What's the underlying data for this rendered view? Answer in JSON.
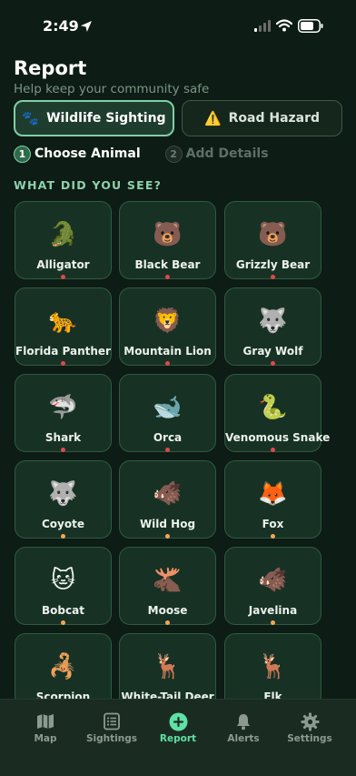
{
  "status": {
    "time": "2:49"
  },
  "header": {
    "title": "Report",
    "subtitle": "Help keep your community safe"
  },
  "segments": {
    "wildlife": {
      "label": "Wildlife Sighting",
      "icon": "🐾"
    },
    "road": {
      "label": "Road Hazard",
      "icon": "⚠️"
    }
  },
  "steps": [
    {
      "num": "1",
      "label": "Choose Animal"
    },
    {
      "num": "2",
      "label": "Add Details"
    }
  ],
  "section_label": "WHAT DID YOU SEE?",
  "colors": {
    "accent": "#5fe0a4",
    "danger_dot": "#e0474c",
    "caution_dot": "#f2a65a"
  },
  "animals": [
    {
      "name": "Alligator",
      "emoji": "🐊",
      "risk": "danger"
    },
    {
      "name": "Black Bear",
      "emoji": "🐻",
      "risk": "danger"
    },
    {
      "name": "Grizzly Bear",
      "emoji": "🐻",
      "risk": "danger"
    },
    {
      "name": "Florida Panther",
      "emoji": "🐆",
      "risk": "danger"
    },
    {
      "name": "Mountain Lion",
      "emoji": "🦁",
      "risk": "danger"
    },
    {
      "name": "Gray Wolf",
      "emoji": "🐺",
      "risk": "danger"
    },
    {
      "name": "Shark",
      "emoji": "🦈",
      "risk": "danger"
    },
    {
      "name": "Orca",
      "emoji": "🐋",
      "risk": "danger"
    },
    {
      "name": "Venomous Snake",
      "emoji": "🐍",
      "risk": "danger"
    },
    {
      "name": "Coyote",
      "emoji": "🐺",
      "risk": "caution"
    },
    {
      "name": "Wild Hog",
      "emoji": "🐗",
      "risk": "caution"
    },
    {
      "name": "Fox",
      "emoji": "🦊",
      "risk": "caution"
    },
    {
      "name": "Bobcat",
      "emoji": "🐱",
      "risk": "caution"
    },
    {
      "name": "Moose",
      "emoji": "🫎",
      "risk": "caution"
    },
    {
      "name": "Javelina",
      "emoji": "🐗",
      "risk": "caution"
    },
    {
      "name": "Scorpion",
      "emoji": "🦂",
      "risk": "caution"
    },
    {
      "name": "White-Tail Deer",
      "emoji": "🦌",
      "risk": "caution"
    },
    {
      "name": "Elk",
      "emoji": "🦌",
      "risk": "caution"
    }
  ],
  "tabs": [
    {
      "label": "Map",
      "icon": "map-icon",
      "active": false
    },
    {
      "label": "Sightings",
      "icon": "list-icon",
      "active": false
    },
    {
      "label": "Report",
      "icon": "plus-circle-icon",
      "active": true
    },
    {
      "label": "Alerts",
      "icon": "bell-icon",
      "active": false
    },
    {
      "label": "Settings",
      "icon": "gear-icon",
      "active": false
    }
  ]
}
